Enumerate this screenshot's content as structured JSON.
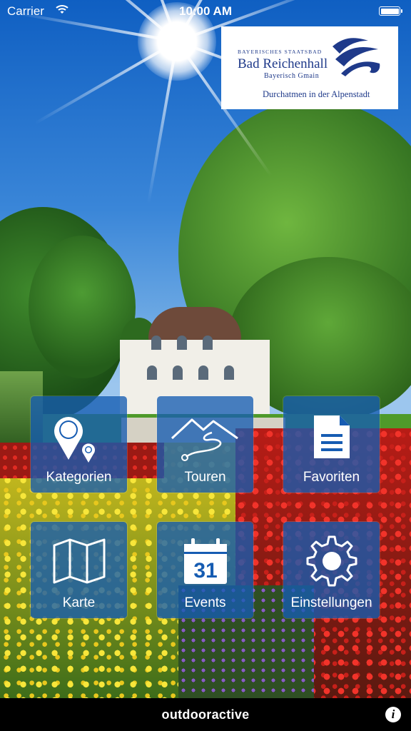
{
  "status_bar": {
    "carrier": "Carrier",
    "time": "10:00 AM"
  },
  "logo": {
    "small_text": "BAYERISCHES STAATSBAD",
    "name": "Bad Reichenhall",
    "subtitle": "Bayerisch Gmain",
    "slogan": "Durchatmen in der Alpenstadt",
    "brand_color": "#1f3a8a"
  },
  "tiles": [
    {
      "label": "Kategorien",
      "icon": "location-pin-icon"
    },
    {
      "label": "Touren",
      "icon": "mountain-route-icon"
    },
    {
      "label": "Favoriten",
      "icon": "document-icon"
    },
    {
      "label": "Karte",
      "icon": "map-icon"
    },
    {
      "label": "Events",
      "icon": "calendar-icon",
      "icon_text": "31"
    },
    {
      "label": "Einstellungen",
      "icon": "gear-icon"
    }
  ],
  "bottom_bar": {
    "brand": "outdooractive",
    "info_symbol": "i"
  },
  "colors": {
    "tile_background": "#165cb2",
    "bottom_bar": "#000000"
  }
}
